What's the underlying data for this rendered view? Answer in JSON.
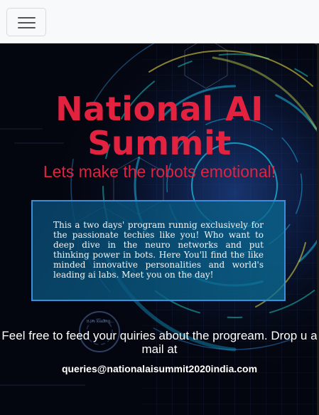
{
  "navbar": {
    "toggler_icon": "hamburger-menu-icon"
  },
  "hero": {
    "title": "National AI Summit",
    "tagline": "Lets make the robots emotional!",
    "description": "This a two days' program runnig exclusively for the passionate techies like you! Who want to deep dive in the neuro networks and put thinking power in bots. Here You'll find the like minded innovative personalities and world's leading ai labs. Meet you on the day!",
    "cta_line": "Feel free to feed your quiries about the progream. Drop u a mail at",
    "email": "queries@nationalaisummit2020india.com",
    "decor_label": "87% loading..."
  },
  "colors": {
    "accent": "#e2223f",
    "box_border": "#3a8fd8",
    "background": "#050814",
    "navbar": "#f8f9fa"
  }
}
